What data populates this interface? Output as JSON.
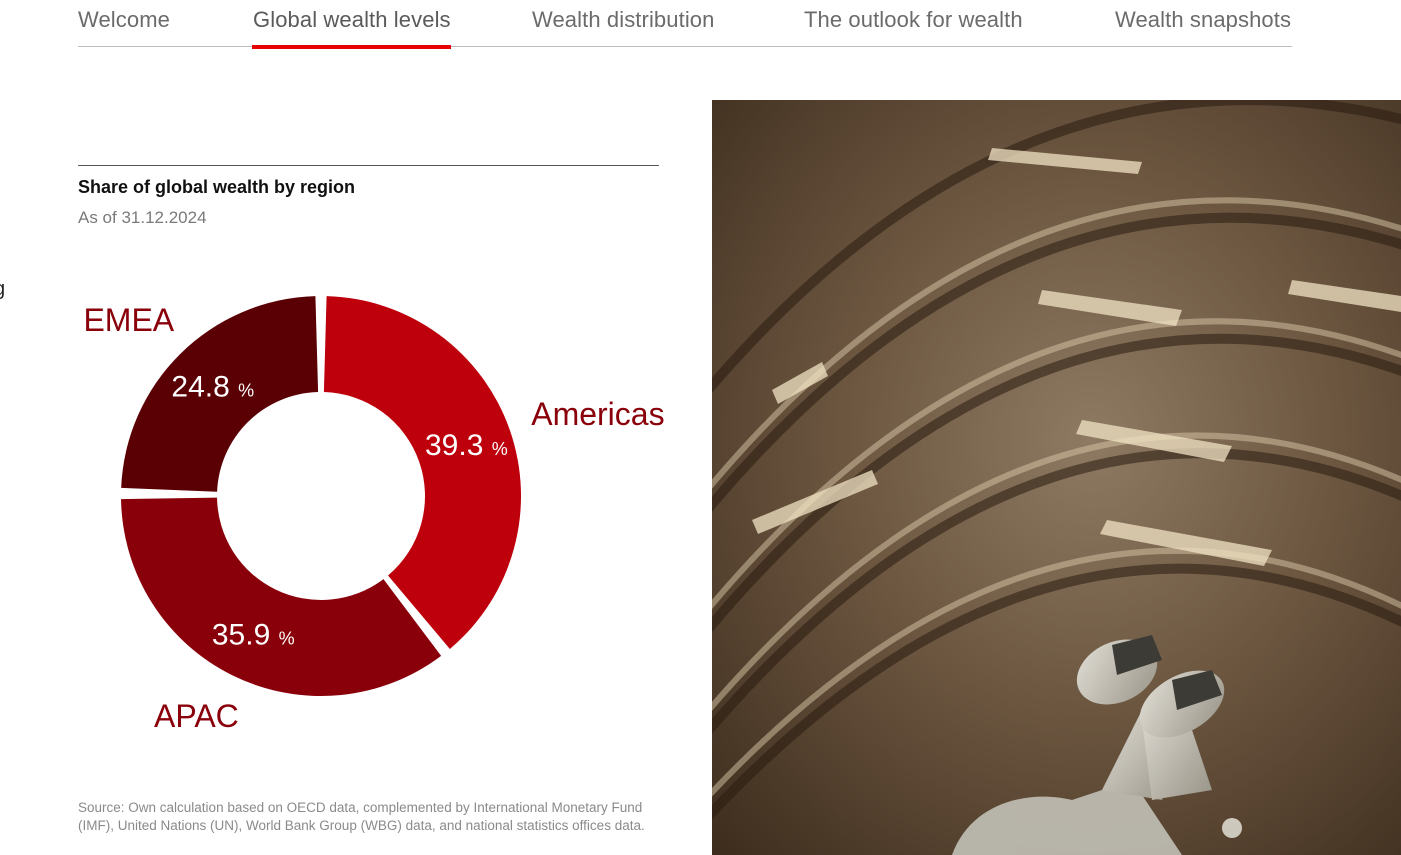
{
  "nav": {
    "tabs": [
      {
        "label": "Welcome",
        "active": false
      },
      {
        "label": "Global wealth levels",
        "active": true
      },
      {
        "label": "Wealth distribution",
        "active": false
      },
      {
        "label": "The outlook for wealth",
        "active": false
      },
      {
        "label": "Wealth snapshots",
        "active": false
      }
    ],
    "active_color": "#e60000"
  },
  "edge_glyphs": [
    "g",
    "l"
  ],
  "chart_data": {
    "type": "pie",
    "title": "Share of global wealth by region",
    "subtitle": "As of 31.12.2024",
    "slices": [
      {
        "label": "Americas",
        "value": 39.3,
        "unit": "%",
        "color": "#bd000c"
      },
      {
        "label": "APAC",
        "value": 35.9,
        "unit": "%",
        "color": "#8a000a"
      },
      {
        "label": "EMEA",
        "value": 24.8,
        "unit": "%",
        "color": "#5a0005"
      }
    ],
    "label_color": "#8a000a",
    "value_text_color": "#ffffff"
  },
  "source_text": "Source: Own calculation based on OECD data, complemented by International Monetary Fund (IMF), United Nations (UN), World Bank Group (WBG) data, and national statistics offices data."
}
